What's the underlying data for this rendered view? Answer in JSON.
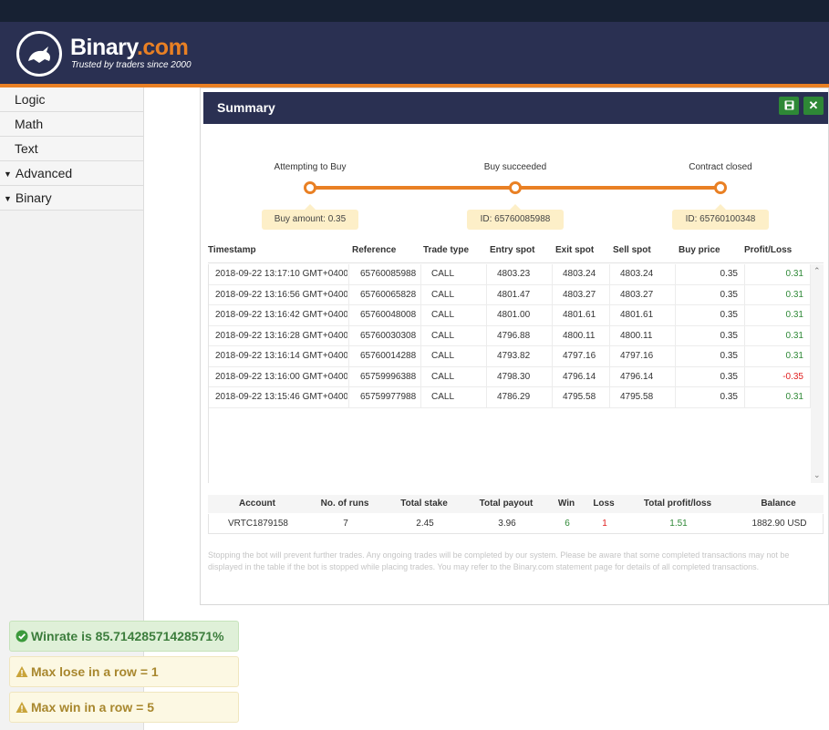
{
  "brand": {
    "name_main": "Binary",
    "name_suffix": ".com",
    "tagline": "Trusted by traders since 2000"
  },
  "sidebar": {
    "items": [
      {
        "label": "Logic",
        "expandable": false
      },
      {
        "label": "Math",
        "expandable": false
      },
      {
        "label": "Text",
        "expandable": false
      },
      {
        "label": "Advanced",
        "expandable": true
      },
      {
        "label": "Binary",
        "expandable": true
      }
    ]
  },
  "summary": {
    "title": "Summary",
    "steps": [
      {
        "label": "Attempting to Buy",
        "bubble": "Buy amount: 0.35"
      },
      {
        "label": "Buy succeeded",
        "bubble": "ID: 65760085988"
      },
      {
        "label": "Contract closed",
        "bubble": "ID: 65760100348"
      }
    ],
    "columns": [
      "Timestamp",
      "Reference",
      "Trade type",
      "Entry spot",
      "Exit spot",
      "Sell spot",
      "Buy price",
      "Profit/Loss"
    ],
    "rows": [
      {
        "timestamp": "2018-09-22 13:17:10 GMT+0400",
        "reference": "65760085988",
        "trade_type": "CALL",
        "entry": "4803.23",
        "exit": "4803.24",
        "sell": "4803.24",
        "buy_price": "0.35",
        "pl": "0.31"
      },
      {
        "timestamp": "2018-09-22 13:16:56 GMT+0400",
        "reference": "65760065828",
        "trade_type": "CALL",
        "entry": "4801.47",
        "exit": "4803.27",
        "sell": "4803.27",
        "buy_price": "0.35",
        "pl": "0.31"
      },
      {
        "timestamp": "2018-09-22 13:16:42 GMT+0400",
        "reference": "65760048008",
        "trade_type": "CALL",
        "entry": "4801.00",
        "exit": "4801.61",
        "sell": "4801.61",
        "buy_price": "0.35",
        "pl": "0.31"
      },
      {
        "timestamp": "2018-09-22 13:16:28 GMT+0400",
        "reference": "65760030308",
        "trade_type": "CALL",
        "entry": "4796.88",
        "exit": "4800.11",
        "sell": "4800.11",
        "buy_price": "0.35",
        "pl": "0.31"
      },
      {
        "timestamp": "2018-09-22 13:16:14 GMT+0400",
        "reference": "65760014288",
        "trade_type": "CALL",
        "entry": "4793.82",
        "exit": "4797.16",
        "sell": "4797.16",
        "buy_price": "0.35",
        "pl": "0.31"
      },
      {
        "timestamp": "2018-09-22 13:16:00 GMT+0400",
        "reference": "65759996388",
        "trade_type": "CALL",
        "entry": "4798.30",
        "exit": "4796.14",
        "sell": "4796.14",
        "buy_price": "0.35",
        "pl": "-0.35"
      },
      {
        "timestamp": "2018-09-22 13:15:46 GMT+0400",
        "reference": "65759977988",
        "trade_type": "CALL",
        "entry": "4786.29",
        "exit": "4795.58",
        "sell": "4795.58",
        "buy_price": "0.35",
        "pl": "0.31"
      }
    ],
    "stats_columns": [
      "Account",
      "No. of runs",
      "Total stake",
      "Total payout",
      "Win",
      "Loss",
      "Total profit/loss",
      "Balance"
    ],
    "stats": {
      "account": "VRTC1879158",
      "runs": "7",
      "stake": "2.45",
      "payout": "3.96",
      "win": "6",
      "loss": "1",
      "profit": "1.51",
      "balance": "1882.90 USD"
    },
    "disclaimer": "Stopping the bot will prevent further trades. Any ongoing trades will be completed by our system. Please be aware that some completed transactions may not be displayed in the table if the bot is stopped while placing trades. You may refer to the Binary.com statement page for details of all completed transactions."
  },
  "notifications": [
    {
      "type": "success",
      "text": "Winrate is 85.71428571428571%"
    },
    {
      "type": "warning",
      "text": "Max lose in a row = 1"
    },
    {
      "type": "warning",
      "text": "Max win in a row = 5"
    }
  ],
  "colors": {
    "header": "#2a3052",
    "accent": "#e98024",
    "profit": "#2e8836",
    "loss": "#e02020"
  }
}
